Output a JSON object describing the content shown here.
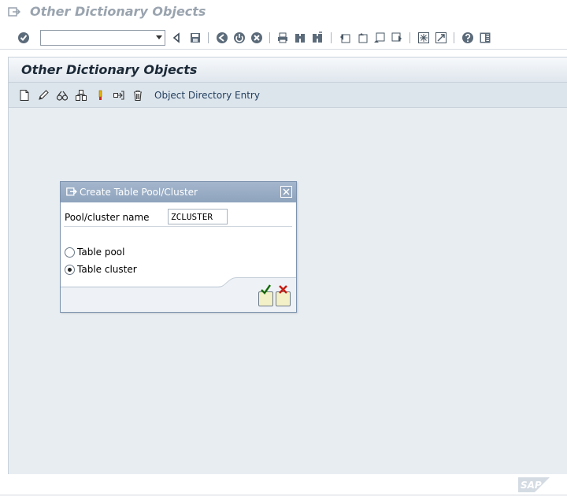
{
  "window": {
    "title": "Other Dictionary Objects",
    "logo": "SAP"
  },
  "system_toolbar": {
    "command_field_value": "",
    "icons": [
      "enter-icon",
      "back-icon",
      "save-icon",
      "back-nav-icon",
      "exit-icon",
      "cancel-icon",
      "print-icon",
      "find-icon",
      "find-next-icon",
      "first-page-icon",
      "previous-page-icon",
      "next-page-icon",
      "last-page-icon",
      "create-session-icon",
      "shortcut-icon",
      "help-icon",
      "layout-menu-icon"
    ]
  },
  "page": {
    "title": "Other Dictionary Objects",
    "toolbar": {
      "icons": [
        "create-icon",
        "change-icon",
        "display-icon",
        "copy-icon",
        "activate-icon",
        "where-used-icon",
        "delete-icon"
      ],
      "link": "Object Directory Entry"
    }
  },
  "dialog": {
    "title": "Create Table Pool/Cluster",
    "field_label": "Pool/cluster name",
    "field_value": "ZCLUSTER",
    "options": [
      {
        "label": "Table pool",
        "selected": false
      },
      {
        "label": "Table cluster",
        "selected": true
      }
    ]
  },
  "colors": {
    "dialog_header": "#8ea3bd",
    "title_text": "#9aa4af",
    "page_background": "#e8edf2"
  }
}
